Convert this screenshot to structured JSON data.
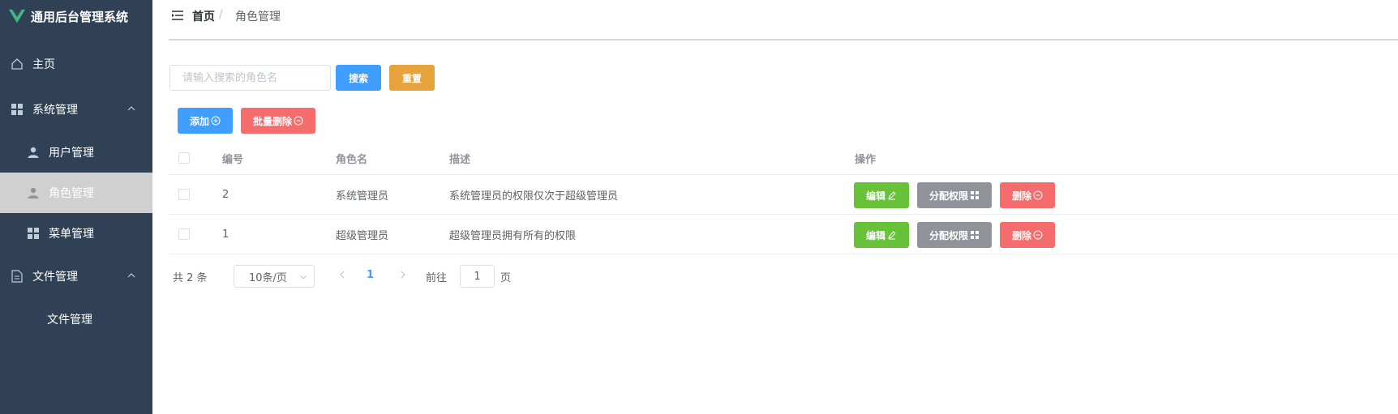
{
  "app": {
    "title": "通用后台管理系统"
  },
  "sidebar": {
    "home": "主页",
    "system": "系统管理",
    "user_mgmt": "用户管理",
    "role_mgmt": "角色管理",
    "menu_mgmt": "菜单管理",
    "file": "文件管理",
    "file_mgmt": "文件管理"
  },
  "breadcrumb": {
    "home": "首页",
    "separator": "/",
    "current": "角色管理"
  },
  "search": {
    "placeholder": "请输入搜索的角色名",
    "value": "",
    "search_label": "搜索",
    "reset_label": "重置"
  },
  "toolbar": {
    "add_label": "添加",
    "batch_delete_label": "批量删除"
  },
  "table": {
    "headers": {
      "id": "编号",
      "name": "角色名",
      "description": "描述",
      "actions": "操作"
    },
    "rows": [
      {
        "id": "2",
        "name": "系统管理员",
        "description": "系统管理员的权限仅次于超级管理员"
      },
      {
        "id": "1",
        "name": "超级管理员",
        "description": "超级管理员拥有所有的权限"
      }
    ],
    "actions": {
      "edit": "编辑",
      "assign": "分配权限",
      "delete": "删除"
    }
  },
  "pagination": {
    "total": "共 2 条",
    "page_size": "10条/页",
    "current_page": "1",
    "goto_label": "前往",
    "goto_value": "1",
    "page_suffix": "页"
  },
  "colors": {
    "sidebar_bg": "#304156",
    "primary": "#409eff",
    "warning": "#e6a23c",
    "danger": "#f56c6c",
    "success": "#67c23a",
    "info": "#909399",
    "logo": "#41b883"
  }
}
